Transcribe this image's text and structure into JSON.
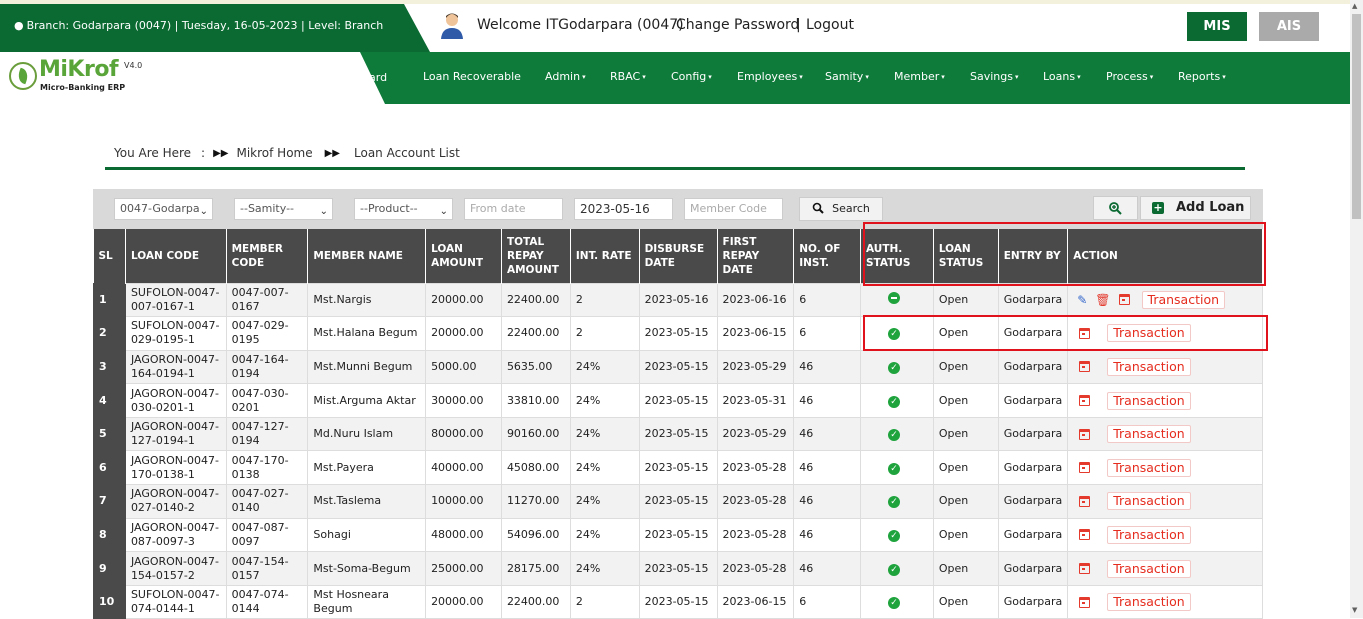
{
  "header": {
    "branch_info": "Branch: Godarpara (0047) | Tuesday, 16-05-2023 | Level: Branch",
    "welcome": "Welcome ITGodarpara (0047)",
    "change_password": "Change Password",
    "separator": "|",
    "logout": "Logout",
    "mis": "MIS",
    "ais": "AIS"
  },
  "logo": {
    "name": "MiKrof",
    "version": "V4.0",
    "subtitle": "Micro-Banking ERP"
  },
  "nav": {
    "ghost_item": "ard",
    "items": [
      "Loan Recoverable",
      "Admin",
      "RBAC",
      "Config",
      "Employees",
      "Samity",
      "Member",
      "Savings",
      "Loans",
      "Process",
      "Reports"
    ]
  },
  "breadcrumb": {
    "prefix": "You Are Here",
    "colon": ":",
    "home": "Mikrof Home",
    "current": "Loan Account List"
  },
  "filters": {
    "branch": "0047-Godarpa",
    "samity": "--Samity--",
    "product": "--Product--",
    "from_date_placeholder": "From date",
    "to_date": "2023-05-16",
    "member_code_placeholder": "Member Code",
    "search": "Search",
    "add_loan": "Add Loan"
  },
  "table": {
    "headers": [
      "SL",
      "LOAN CODE",
      "MEMBER CODE",
      "MEMBER NAME",
      "LOAN AMOUNT",
      "TOTAL REPAY AMOUNT",
      "INT. RATE",
      "DISBURSE DATE",
      "FIRST REPAY DATE",
      "NO. OF INST.",
      "AUTH. STATUS",
      "LOAN STATUS",
      "ENTRY BY",
      "ACTION"
    ],
    "transaction_label": "Transaction",
    "rows": [
      {
        "sl": "1",
        "loan_code": "SUFOLON-0047-007-0167-1",
        "member_code": "0047-007-0167",
        "member_name": "Mst.Nargis",
        "loan_amount": "20000.00",
        "total_repay": "22400.00",
        "int_rate": "2",
        "disburse": "2023-05-16",
        "first_repay": "2023-06-16",
        "inst": "6",
        "auth": "pending",
        "loan_status": "Open",
        "entry_by": "Godarpara"
      },
      {
        "sl": "2",
        "loan_code": "SUFOLON-0047-029-0195-1",
        "member_code": "0047-029-0195",
        "member_name": "Mst.Halana Begum",
        "loan_amount": "20000.00",
        "total_repay": "22400.00",
        "int_rate": "2",
        "disburse": "2023-05-15",
        "first_repay": "2023-06-15",
        "inst": "6",
        "auth": "approved",
        "loan_status": "Open",
        "entry_by": "Godarpara"
      },
      {
        "sl": "3",
        "loan_code": "JAGORON-0047-164-0194-1",
        "member_code": "0047-164-0194",
        "member_name": "Mst.Munni Begum",
        "loan_amount": "5000.00",
        "total_repay": "5635.00",
        "int_rate": "24%",
        "disburse": "2023-05-15",
        "first_repay": "2023-05-29",
        "inst": "46",
        "auth": "approved",
        "loan_status": "Open",
        "entry_by": "Godarpara"
      },
      {
        "sl": "4",
        "loan_code": "JAGORON-0047-030-0201-1",
        "member_code": "0047-030-0201",
        "member_name": "Mist.Arguma Aktar",
        "loan_amount": "30000.00",
        "total_repay": "33810.00",
        "int_rate": "24%",
        "disburse": "2023-05-15",
        "first_repay": "2023-05-31",
        "inst": "46",
        "auth": "approved",
        "loan_status": "Open",
        "entry_by": "Godarpara"
      },
      {
        "sl": "5",
        "loan_code": "JAGORON-0047-127-0194-1",
        "member_code": "0047-127-0194",
        "member_name": "Md.Nuru Islam",
        "loan_amount": "80000.00",
        "total_repay": "90160.00",
        "int_rate": "24%",
        "disburse": "2023-05-15",
        "first_repay": "2023-05-29",
        "inst": "46",
        "auth": "approved",
        "loan_status": "Open",
        "entry_by": "Godarpara"
      },
      {
        "sl": "6",
        "loan_code": "JAGORON-0047-170-0138-1",
        "member_code": "0047-170-0138",
        "member_name": "Mst.Payera",
        "loan_amount": "40000.00",
        "total_repay": "45080.00",
        "int_rate": "24%",
        "disburse": "2023-05-15",
        "first_repay": "2023-05-28",
        "inst": "46",
        "auth": "approved",
        "loan_status": "Open",
        "entry_by": "Godarpara"
      },
      {
        "sl": "7",
        "loan_code": "JAGORON-0047-027-0140-2",
        "member_code": "0047-027-0140",
        "member_name": "Mst.Taslema",
        "loan_amount": "10000.00",
        "total_repay": "11270.00",
        "int_rate": "24%",
        "disburse": "2023-05-15",
        "first_repay": "2023-05-28",
        "inst": "46",
        "auth": "approved",
        "loan_status": "Open",
        "entry_by": "Godarpara"
      },
      {
        "sl": "8",
        "loan_code": "JAGORON-0047-087-0097-3",
        "member_code": "0047-087-0097",
        "member_name": "Sohagi",
        "loan_amount": "48000.00",
        "total_repay": "54096.00",
        "int_rate": "24%",
        "disburse": "2023-05-15",
        "first_repay": "2023-05-28",
        "inst": "46",
        "auth": "approved",
        "loan_status": "Open",
        "entry_by": "Godarpara"
      },
      {
        "sl": "9",
        "loan_code": "JAGORON-0047-154-0157-2",
        "member_code": "0047-154-0157",
        "member_name": "Mst-Soma-Begum",
        "loan_amount": "25000.00",
        "total_repay": "28175.00",
        "int_rate": "24%",
        "disburse": "2023-05-15",
        "first_repay": "2023-05-28",
        "inst": "46",
        "auth": "approved",
        "loan_status": "Open",
        "entry_by": "Godarpara"
      },
      {
        "sl": "10",
        "loan_code": "SUFOLON-0047-074-0144-1",
        "member_code": "0047-074-0144",
        "member_name": "Mst Hosneara Begum",
        "loan_amount": "20000.00",
        "total_repay": "22400.00",
        "int_rate": "2",
        "disburse": "2023-05-15",
        "first_repay": "2023-06-15",
        "inst": "6",
        "auth": "approved",
        "loan_status": "Open",
        "entry_by": "Godarpara"
      }
    ]
  },
  "colors": {
    "brand_green": "#0b6a32",
    "nav_green": "#0f7b3a",
    "header_gray": "#4a4a4a",
    "danger_red": "#e52d1f",
    "highlight_red": "#e0121c"
  }
}
